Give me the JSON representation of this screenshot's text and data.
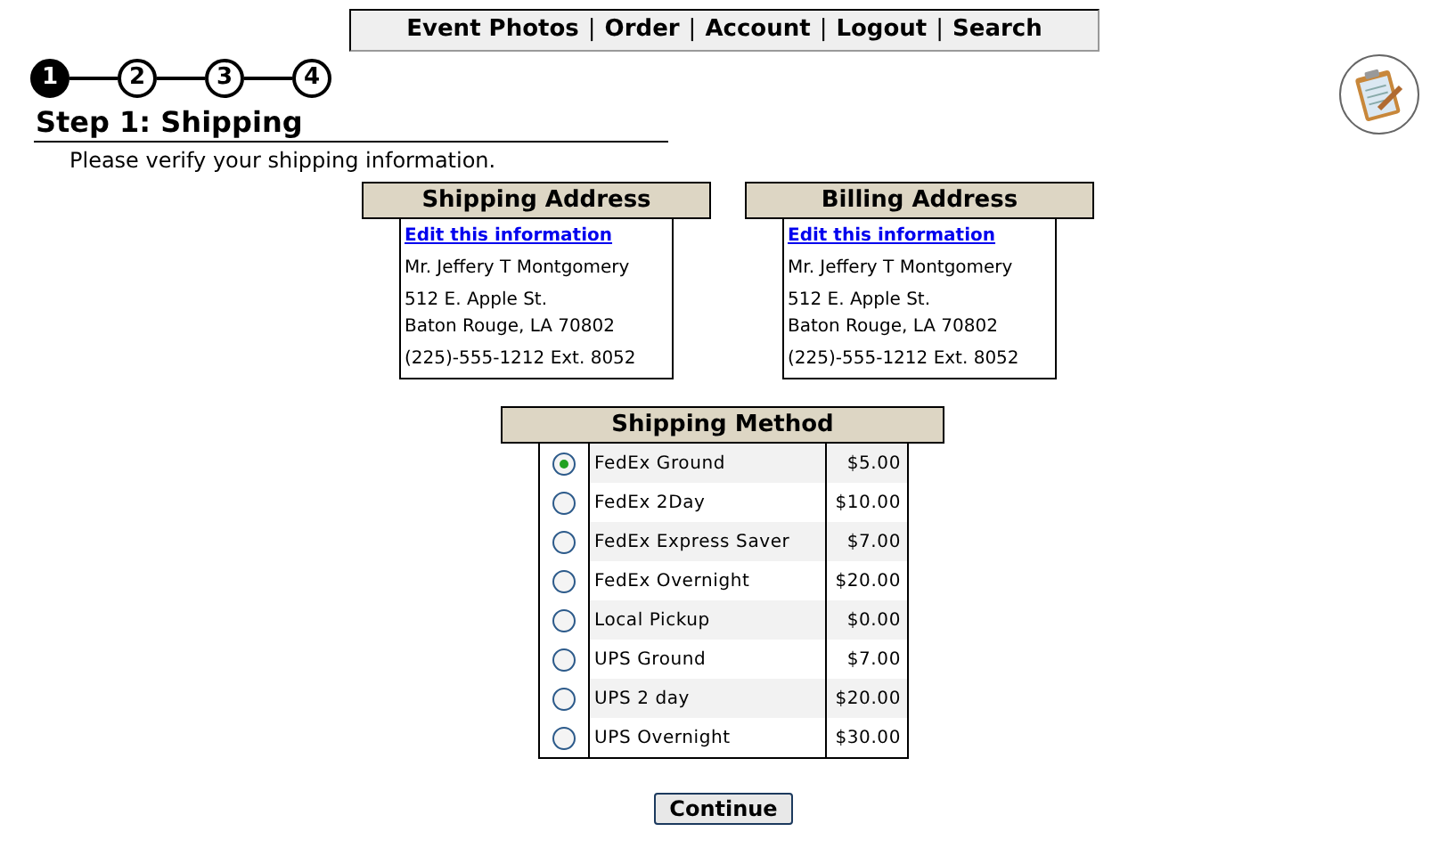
{
  "nav": {
    "separator": "|",
    "links": [
      "Event Photos",
      "Order",
      "Account",
      "Logout",
      "Search"
    ]
  },
  "steps": [
    {
      "label": "1",
      "selected": true
    },
    {
      "label": "2",
      "selected": false
    },
    {
      "label": "3",
      "selected": false
    },
    {
      "label": "4",
      "selected": false
    }
  ],
  "title": "Step 1: Shipping",
  "intro": "Please verify your shipping information.",
  "addresses": [
    {
      "heading": "Shipping Address",
      "edit_link": "Edit this information",
      "name": "Mr. Jeffery T Montgomery",
      "street": "512 E. Apple St.",
      "city": "Baton Rouge, LA 70802",
      "phone": "(225)-555-1212 Ext. 8052"
    },
    {
      "heading": "Billing Address",
      "edit_link": "Edit this information",
      "name": "Mr. Jeffery T Montgomery",
      "street": "512 E. Apple St.",
      "city": "Baton Rouge, LA 70802",
      "phone": "(225)-555-1212 Ext. 8052"
    }
  ],
  "shipping_method": {
    "heading": "Shipping Method",
    "options": [
      {
        "name": "FedEx Ground",
        "price": "$5.00",
        "selected": true
      },
      {
        "name": "FedEx 2Day",
        "price": "$10.00",
        "selected": false
      },
      {
        "name": "FedEx Express Saver",
        "price": "$7.00",
        "selected": false
      },
      {
        "name": "FedEx Overnight",
        "price": "$20.00",
        "selected": false
      },
      {
        "name": "Local Pickup",
        "price": "$0.00",
        "selected": false
      },
      {
        "name": "UPS Ground",
        "price": "$7.00",
        "selected": false
      },
      {
        "name": "UPS 2 day",
        "price": "$20.00",
        "selected": false
      },
      {
        "name": "UPS Overnight",
        "price": "$30.00",
        "selected": false
      }
    ]
  },
  "continue_button": "Continue"
}
